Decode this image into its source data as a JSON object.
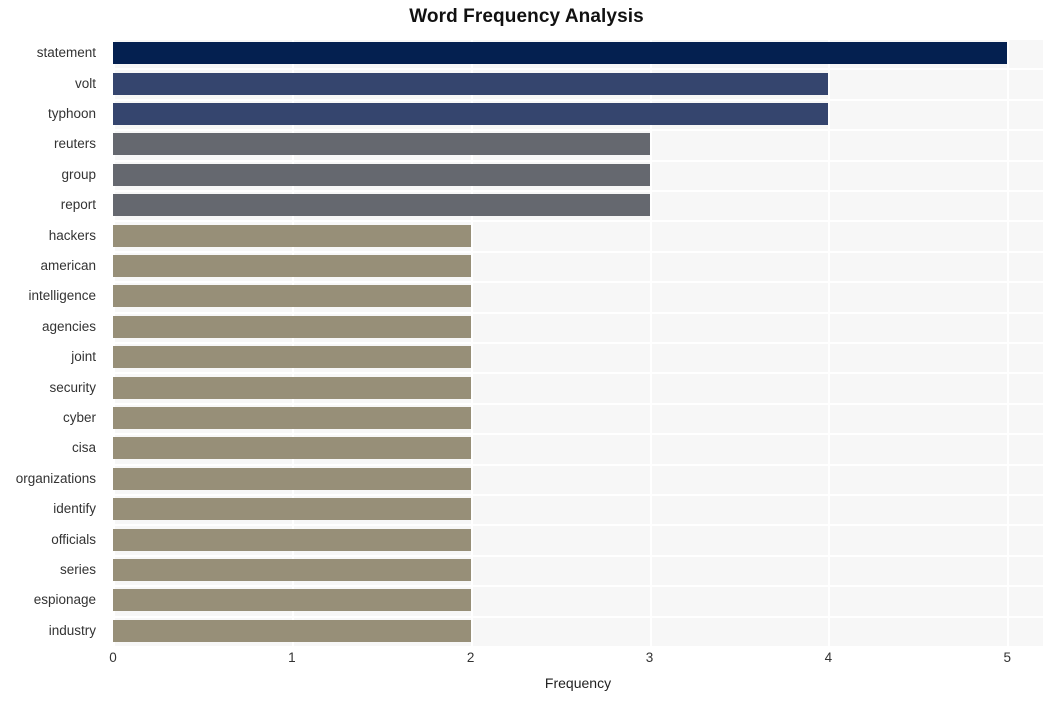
{
  "chart_data": {
    "type": "bar",
    "orientation": "horizontal",
    "title": "Word Frequency Analysis",
    "xlabel": "Frequency",
    "ylabel": "",
    "xlim": [
      0,
      5.2
    ],
    "xticks": [
      "0",
      "1",
      "2",
      "3",
      "4",
      "5"
    ],
    "xtick_values": [
      0,
      1,
      2,
      3,
      4,
      5
    ],
    "grid": true,
    "legend": "none",
    "categories": [
      "statement",
      "volt",
      "typhoon",
      "reuters",
      "group",
      "report",
      "hackers",
      "american",
      "intelligence",
      "agencies",
      "joint",
      "security",
      "cyber",
      "cisa",
      "organizations",
      "identify",
      "officials",
      "series",
      "espionage",
      "industry"
    ],
    "values": [
      5,
      4,
      4,
      3,
      3,
      3,
      2,
      2,
      2,
      2,
      2,
      2,
      2,
      2,
      2,
      2,
      2,
      2,
      2,
      2
    ],
    "bar_colors": [
      "#042050",
      "#35456e",
      "#35456e",
      "#65686f",
      "#65686f",
      "#65686f",
      "#978f78",
      "#978f78",
      "#978f78",
      "#978f78",
      "#978f78",
      "#978f78",
      "#978f78",
      "#978f78",
      "#978f78",
      "#978f78",
      "#978f78",
      "#978f78",
      "#978f78",
      "#978f78"
    ],
    "plot_background": "#f7f7f7",
    "grid_color": "#ffffff",
    "page_background": "#ffffff",
    "tick_text_color": "#333333",
    "title_color": "#111111"
  }
}
